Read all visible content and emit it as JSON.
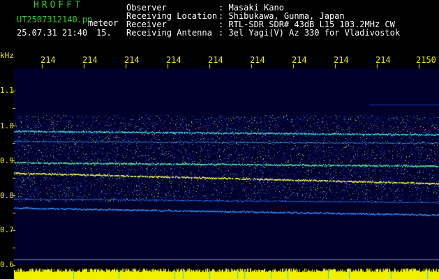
{
  "header": {
    "brand": "HROFFT",
    "filename": "UT2507312140.pn",
    "filename_suffix": "meteor",
    "datetime": "25.07.31 21:40",
    "count": "15."
  },
  "meta": [
    {
      "label": "Observer",
      "value": ": Masaki Kano"
    },
    {
      "label": "Receiving Location",
      "value": ": Shibukawa, Gunma, Japan"
    },
    {
      "label": "Receiver",
      "value": ": RTL-SDR SDR# 43dB L15 103.2MHz CW"
    },
    {
      "label": "Receiving Antenna",
      "value": ": 3el Yagi(V) Az 330 for Vladivostok"
    }
  ],
  "axis": {
    "unit": "kHz",
    "freq_ticks": [
      "1.1",
      "1.0",
      "0.9",
      "0.8",
      "0.7",
      "0.6"
    ],
    "time_labels": [
      "214",
      "214",
      "214",
      "214",
      "214",
      "214",
      "214",
      "214",
      "214",
      "2150"
    ]
  },
  "colors": {
    "green": "#28d228",
    "yellow": "#f0f000",
    "background": "#000000",
    "plot_background": "#00002a"
  }
}
